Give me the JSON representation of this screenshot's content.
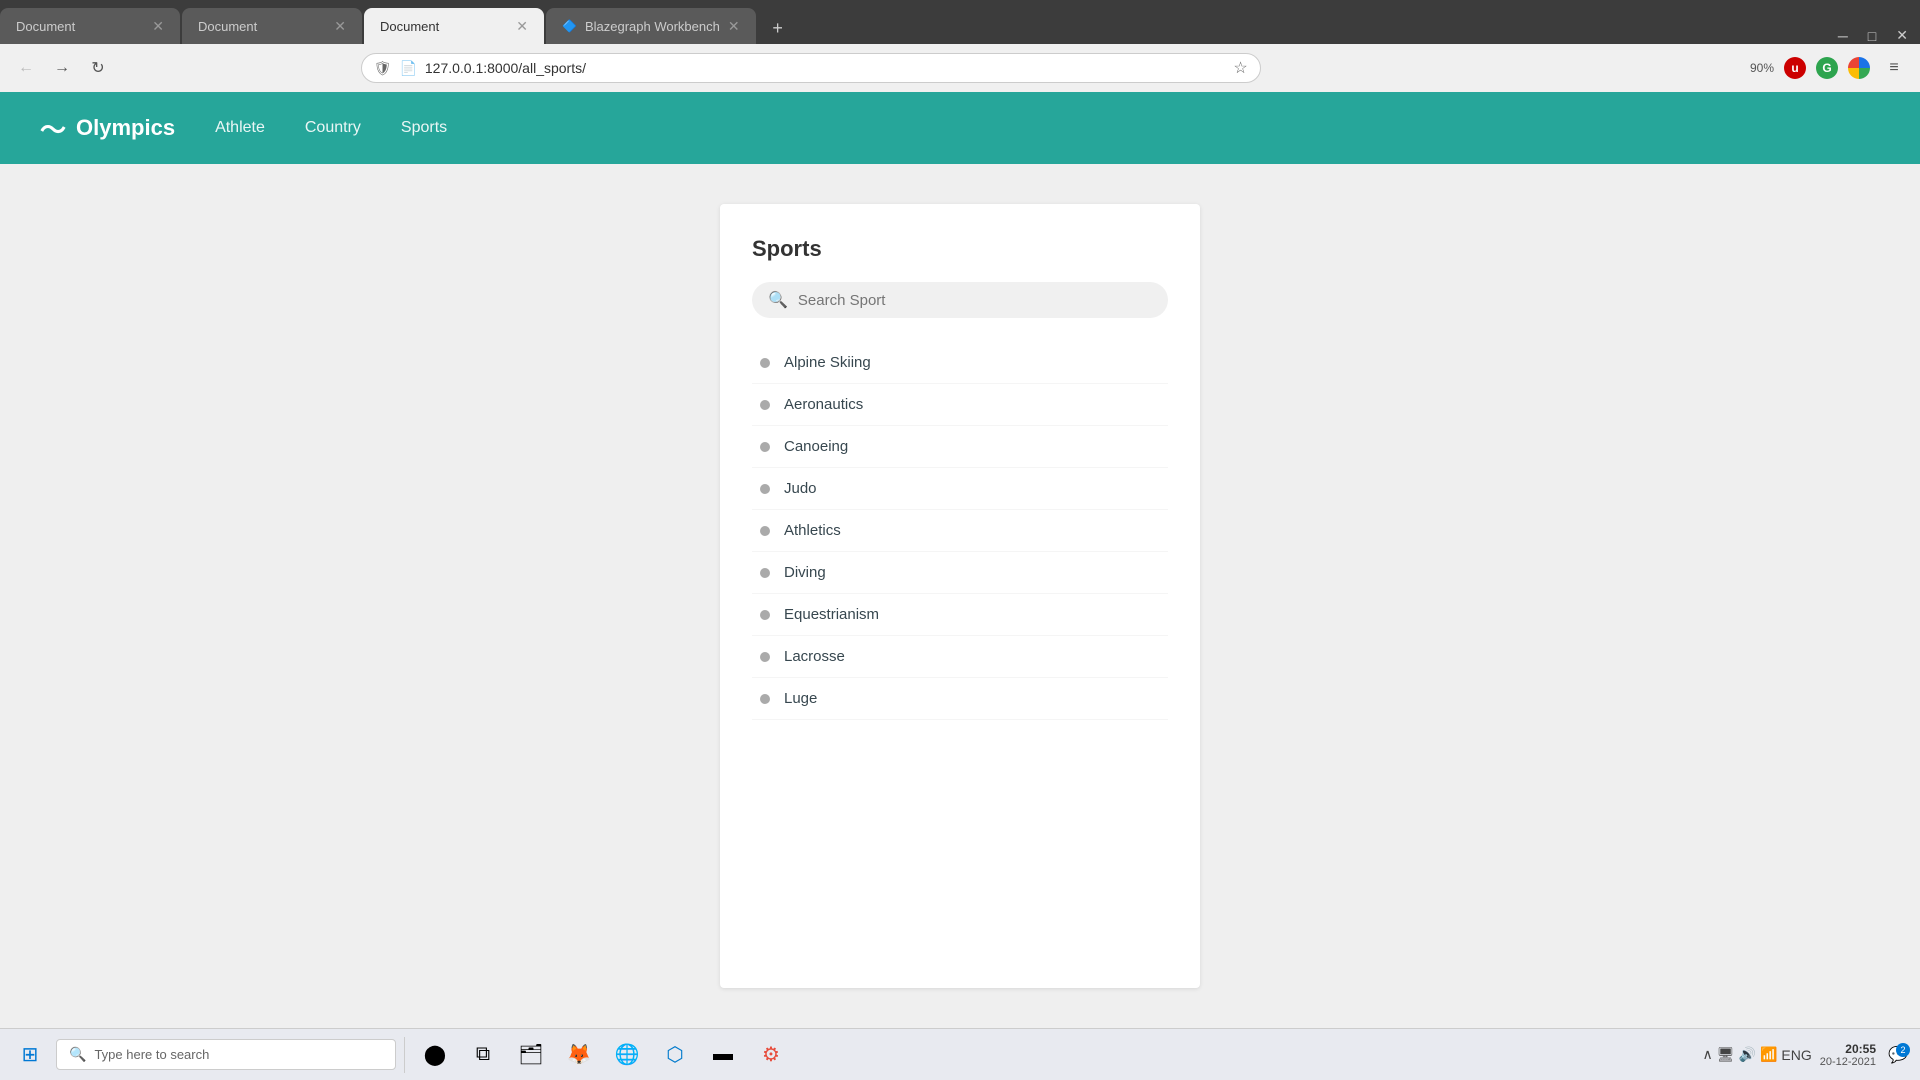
{
  "browser": {
    "tabs": [
      {
        "label": "Document",
        "active": false,
        "id": "tab1"
      },
      {
        "label": "Document",
        "active": false,
        "id": "tab2"
      },
      {
        "label": "Document",
        "active": true,
        "id": "tab3"
      },
      {
        "label": "Blazegraph Workbench",
        "active": false,
        "id": "tab4"
      }
    ],
    "address": "127.0.0.1:8000/all_sports/",
    "zoom": "90%"
  },
  "nav": {
    "logo": "Olympics",
    "links": [
      "Athlete",
      "Country",
      "Sports"
    ]
  },
  "page": {
    "title": "Sports",
    "search_placeholder": "Search Sport",
    "sports": [
      "Alpine Skiing",
      "Aeronautics",
      "Canoeing",
      "Judo",
      "Athletics",
      "Diving",
      "Equestrianism",
      "Lacrosse",
      "Luge"
    ]
  },
  "taskbar": {
    "search_placeholder": "Type here to search",
    "time": "20:55",
    "date": "20-12-2021",
    "lang": "ENG",
    "notif_count": "2"
  }
}
